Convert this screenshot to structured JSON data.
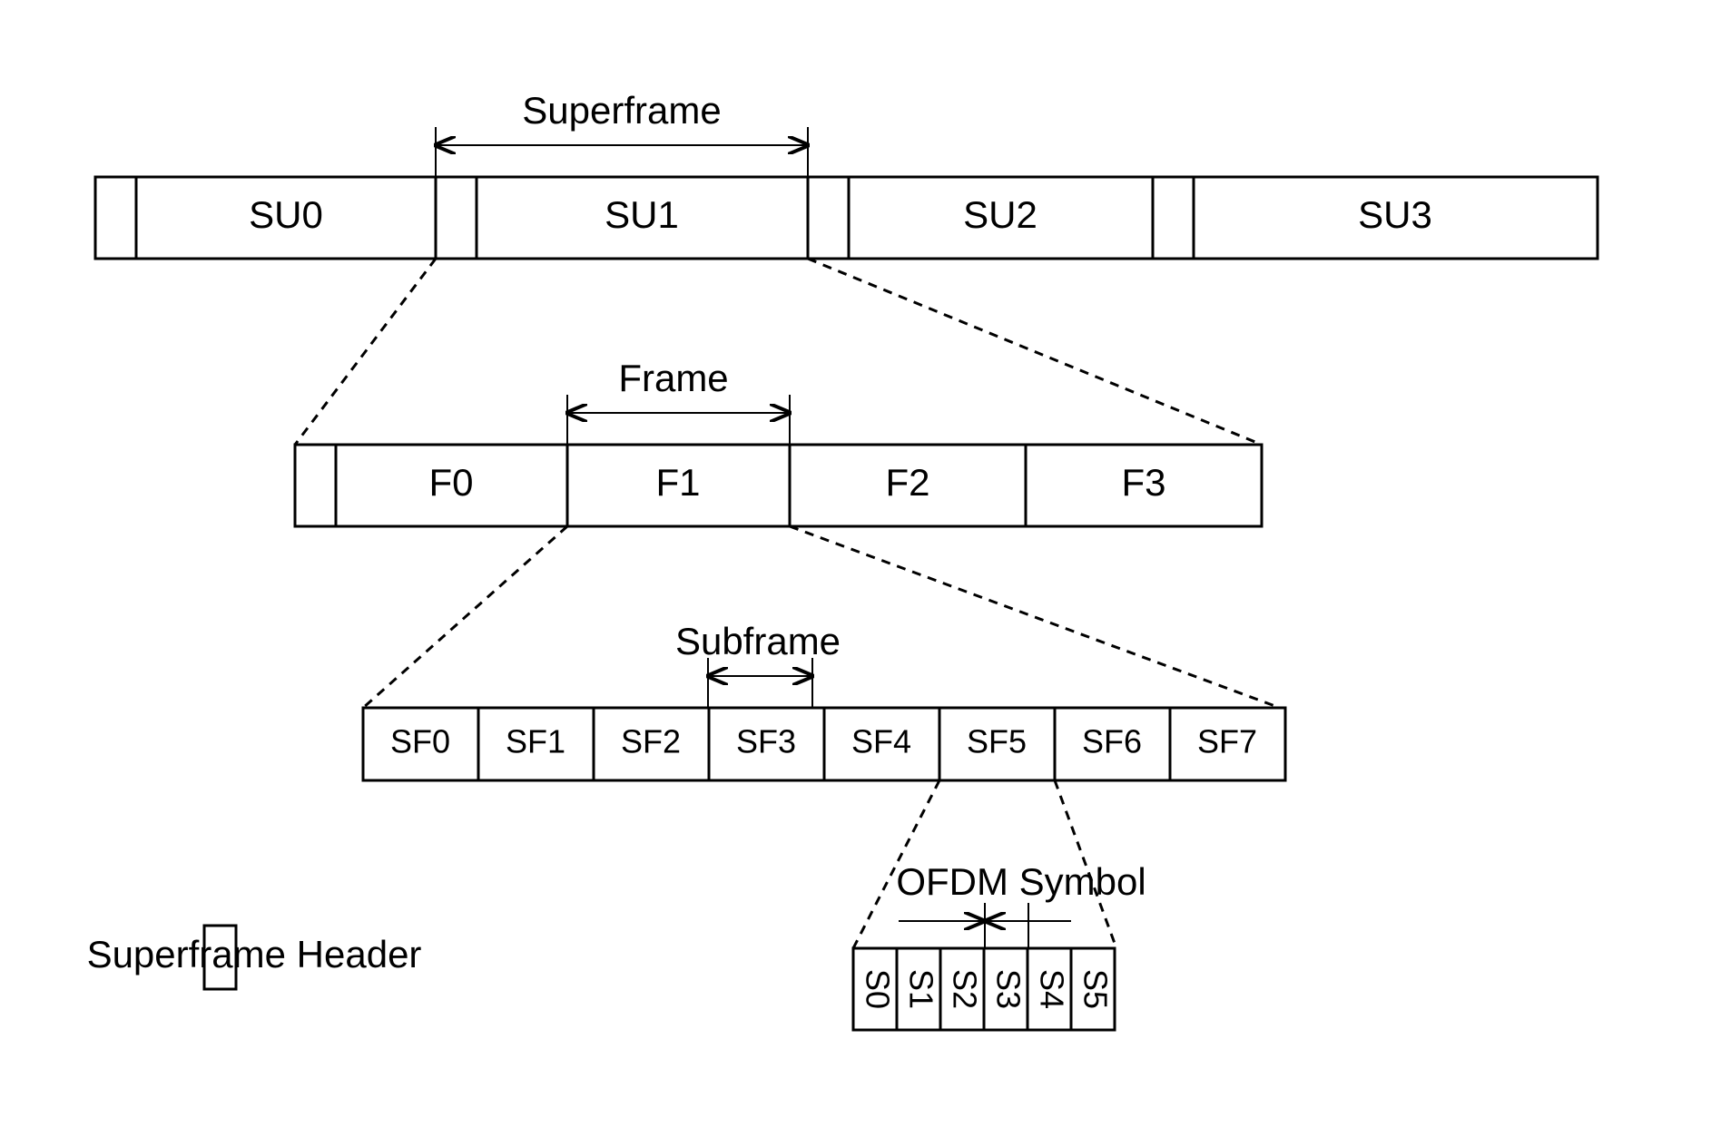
{
  "labels": {
    "superframe": "Superframe",
    "frame": "Frame",
    "subframe": "Subframe",
    "ofdm": "OFDM Symbol",
    "legend": "Superframe Header"
  },
  "superframes": [
    "SU0",
    "SU1",
    "SU2",
    "SU3"
  ],
  "frames": [
    "F0",
    "F1",
    "F2",
    "F3"
  ],
  "subframes": [
    "SF0",
    "SF1",
    "SF2",
    "SF3",
    "SF4",
    "SF5",
    "SF6",
    "SF7"
  ],
  "symbols": [
    "S0",
    "S1",
    "S2",
    "S3",
    "S4",
    "S5"
  ]
}
